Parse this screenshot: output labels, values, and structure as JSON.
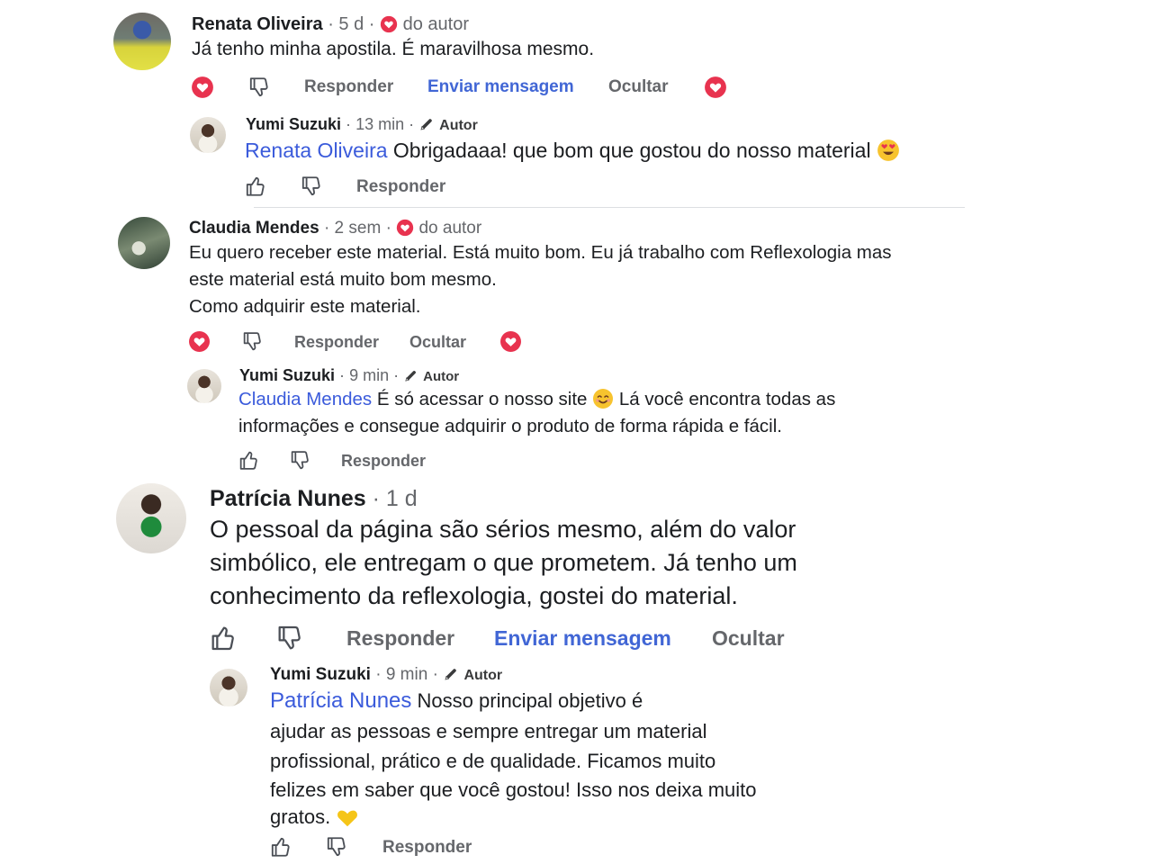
{
  "comments": [
    {
      "author": "Renata Oliveira",
      "time": "5 d",
      "badge_label": "do autor",
      "text": "Já tenho minha apostila. É maravilhosa mesmo.",
      "actions": {
        "reply": "Responder",
        "message": "Enviar mensagem",
        "hide": "Ocultar"
      },
      "reply": {
        "author": "Yumi Suzuki",
        "time": "13 min",
        "role": "Autor",
        "mention": "Renata Oliveira",
        "text": "Obrigadaaa! que bom que gostou do nosso material",
        "reply_label": "Responder"
      }
    },
    {
      "author": "Claudia Mendes",
      "time": "2 sem",
      "badge_label": "do autor",
      "text_lines": [
        "Eu quero receber este material. Está muito bom. Eu já trabalho com Reflexologia mas",
        "este material está muito bom mesmo.",
        "Como adquirir este material."
      ],
      "actions": {
        "reply": "Responder",
        "hide": "Ocultar"
      },
      "reply": {
        "author": "Yumi Suzuki",
        "time": "9 min",
        "role": "Autor",
        "mention": "Claudia Mendes",
        "text_a": "É só acessar o nosso site",
        "text_b": "Lá você encontra todas as",
        "text_line2": "informações e consegue adquirir o produto de forma rápida e fácil.",
        "reply_label": "Responder"
      }
    },
    {
      "author": "Patrícia Nunes",
      "time": "1 d",
      "text_lines": [
        "O pessoal da página são sérios mesmo, além do valor",
        "simbólico, ele entregam o que prometem. Já tenho um",
        "conhecimento da reflexologia, gostei do material."
      ],
      "actions": {
        "reply": "Responder",
        "message": "Enviar mensagem",
        "hide": "Ocultar"
      },
      "reply": {
        "author": "Yumi Suzuki",
        "time": "9 min",
        "role": "Autor",
        "mention": "Patrícia Nunes",
        "text_line1": "Nosso principal objetivo é",
        "text_lines": [
          "ajudar as pessoas e sempre entregar um material",
          "profissional, prático e de qualidade. Ficamos muito",
          "felizes em saber que você gostou! Isso nos deixa muito",
          "gratos."
        ],
        "reply_label": "Responder"
      }
    }
  ],
  "separator": "·",
  "colors": {
    "heart": "#e8334f",
    "link": "#3b5bdb",
    "meta": "#65676b"
  },
  "icons": [
    "heart-icon",
    "thumbs-down-icon",
    "thumbs-up-icon",
    "pencil-icon",
    "heart-eyes-emoji",
    "smile-emoji",
    "yellow-heart-emoji"
  ]
}
